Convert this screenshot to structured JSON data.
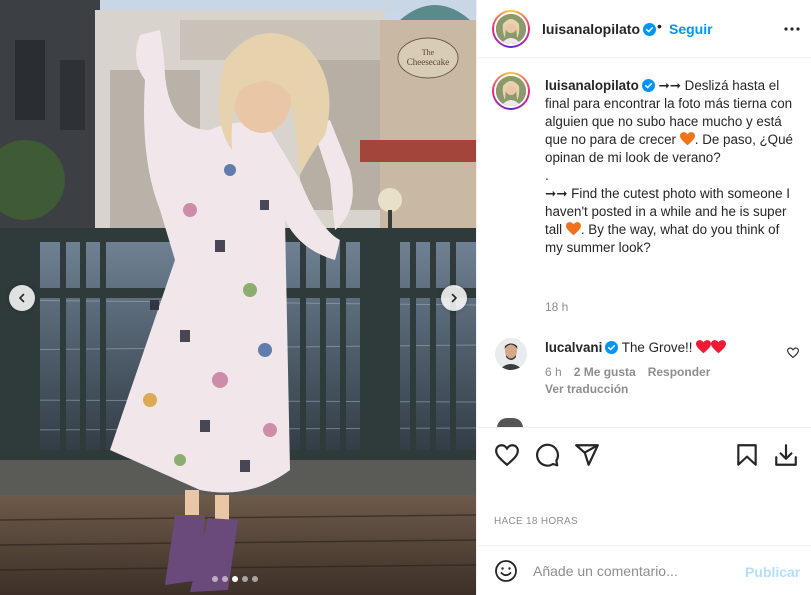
{
  "post": {
    "username": "luisanalopilato",
    "separator": "•",
    "follow_label": "Seguir",
    "more_icon": "more-horizontal-icon",
    "caption_line1": "➞➞ Deslizá hasta el final para encontrar la foto más tierna con alguien que no subo hace mucho y está que no para de crecer ",
    "caption_line2": ". De paso, ¿Qué opinan de mi look de verano?\n.\n➞➞ Find the cutest photo with someone I haven't posted in a while and he is super tall ",
    "caption_line3": ". By the way, what do you think of my summer look?",
    "caption_age": "18 h",
    "heart_color": "#f0731c",
    "verified_color": "#0095f6"
  },
  "comment": {
    "username": "lucalvani",
    "text": "The Grove!!",
    "hearts_color": "#ed1c34",
    "age": "6 h",
    "likes": "2 Me gusta",
    "reply_label": "Responder",
    "translate_label": "Ver traducción"
  },
  "actions": {
    "icons": [
      "heart-icon",
      "comment-icon",
      "share-icon",
      "bookmark-icon",
      "download-icon"
    ],
    "posted_ago": "HACE 18 HORAS"
  },
  "composer": {
    "placeholder": "Añade un comentario...",
    "publish_label": "Publicar"
  },
  "carousel": {
    "slide_count": 5,
    "active_index": 2
  }
}
